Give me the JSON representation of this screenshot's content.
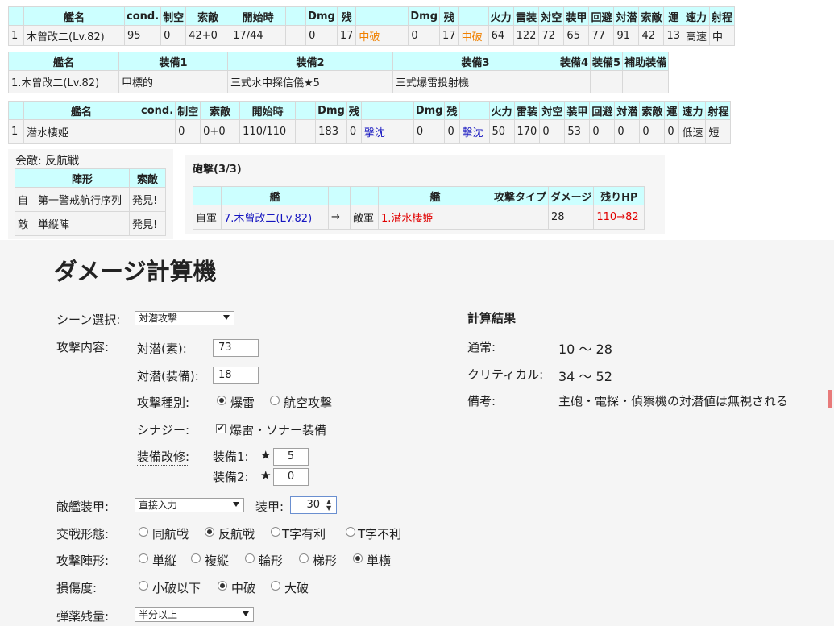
{
  "battle_header": {
    "headers": [
      "艦名",
      "cond.",
      "制空",
      "索敵",
      "開始時",
      "Dmg",
      "残",
      "",
      "Dmg",
      "残",
      "",
      "火力",
      "雷装",
      "対空",
      "装甲",
      "回避",
      "対潜",
      "索敵",
      "運",
      "速力",
      "射程"
    ],
    "row": [
      "1",
      "木曾改二(Lv.82)",
      "95",
      "0",
      "42+0",
      "17/44",
      "0",
      "17",
      "中破",
      "0",
      "17",
      "中破",
      "64",
      "122",
      "72",
      "65",
      "77",
      "91",
      "42",
      "13",
      "高速",
      "中"
    ]
  },
  "equip_table": {
    "headers": [
      "艦名",
      "装備1",
      "装備2",
      "装備3",
      "装備4",
      "装備5",
      "補助装備"
    ],
    "row": [
      "1.木曾改二(Lv.82)",
      "甲標的",
      "三式水中探信儀★5",
      "三式爆雷投射機",
      "",
      "",
      ""
    ]
  },
  "enemy_table": {
    "headers": [
      "艦名",
      "cond.",
      "制空",
      "索敵",
      "開始時",
      "Dmg",
      "残",
      "",
      "Dmg",
      "残",
      "",
      "火力",
      "雷装",
      "対空",
      "装甲",
      "回避",
      "対潜",
      "索敵",
      "運",
      "速力",
      "射程"
    ],
    "row": [
      "1",
      "潜水棲姫",
      "",
      "0",
      "0+0",
      "110/110",
      "183",
      "0",
      "撃沈",
      "0",
      "0",
      "撃沈",
      "50",
      "170",
      "0",
      "53",
      "0",
      "0",
      "0",
      "0",
      "低速",
      "短"
    ]
  },
  "engagement": {
    "title": "会敵: 反航戦",
    "headers": [
      "",
      "陣形",
      "索敵"
    ],
    "rows": [
      [
        "自",
        "第一警戒航行序列",
        "発見!"
      ],
      [
        "敵",
        "単縦陣",
        "発見!"
      ]
    ]
  },
  "shelling": {
    "title": "砲撃(3/3)",
    "headers": [
      "",
      "艦",
      "",
      "",
      "艦",
      "攻撃タイプ",
      "ダメージ",
      "残りHP"
    ],
    "row": [
      "自軍",
      "7.木曾改二(Lv.82)",
      "→",
      "敵軍",
      "1.潜水棲姫",
      "",
      "28",
      "110→82"
    ]
  },
  "calculator": {
    "title": "ダメージ計算機",
    "scene_label": "シーン選択:",
    "scene_value": "対潜攻撃",
    "attack_label": "攻撃内容:",
    "asw_base_label": "対潜(素):",
    "asw_base_value": "73",
    "asw_equip_label": "対潜(装備):",
    "asw_equip_value": "18",
    "attack_type_label": "攻撃種別:",
    "attack_type_options": [
      "爆雷",
      "航空攻撃"
    ],
    "synergy_label": "シナジー:",
    "synergy_option": "爆雷・ソナー装備",
    "improve_label": "装備改修:",
    "improve1_label": "装備1:",
    "improve1_value": "5",
    "improve2_label": "装備2:",
    "improve2_value": "0",
    "star": "★",
    "enemy_armor_label": "敵艦装甲:",
    "enemy_armor_value": "直接入力",
    "armor_label": "装甲:",
    "armor_value": "30",
    "engagement_label": "交戦形態:",
    "engagement_options": [
      "同航戦",
      "反航戦",
      "T字有利",
      "T字不利"
    ],
    "formation_label": "攻撃陣形:",
    "formation_options": [
      "単縦",
      "複縦",
      "輪形",
      "梯形",
      "単横"
    ],
    "damage_label": "損傷度:",
    "damage_options": [
      "小破以下",
      "中破",
      "大破"
    ],
    "ammo_label": "弾薬残量:",
    "ammo_value": "半分以上"
  },
  "result": {
    "title": "計算結果",
    "normal_label": "通常:",
    "normal_value": "10 〜 28",
    "critical_label": "クリティカル:",
    "critical_value": "34 〜 52",
    "note_label": "備考:",
    "note_value": "主砲・電探・偵察機の対潜値は無視される"
  }
}
